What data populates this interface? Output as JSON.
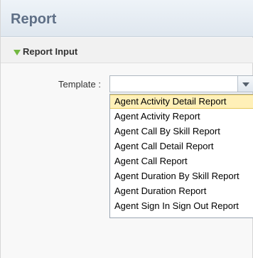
{
  "header": {
    "title": "Report"
  },
  "section": {
    "title": "Report Input",
    "expanded_icon": "triangle-down-icon"
  },
  "template_field": {
    "label": "Template :",
    "value": ""
  },
  "dropdown": {
    "selected_index": 0,
    "options": [
      "Agent Activity Detail Report",
      "Agent Activity Report",
      "Agent Call By Skill Report",
      "Agent Call Detail Report",
      "Agent Call Report",
      "Agent Duration By Skill Report",
      "Agent Duration Report",
      "Agent Sign In Sign Out Report"
    ]
  },
  "colors": {
    "header_text": "#5f6f86",
    "section_arrow": "#73b841",
    "selection_fill": "#fff0b8",
    "selection_border": "#e7c95b"
  }
}
